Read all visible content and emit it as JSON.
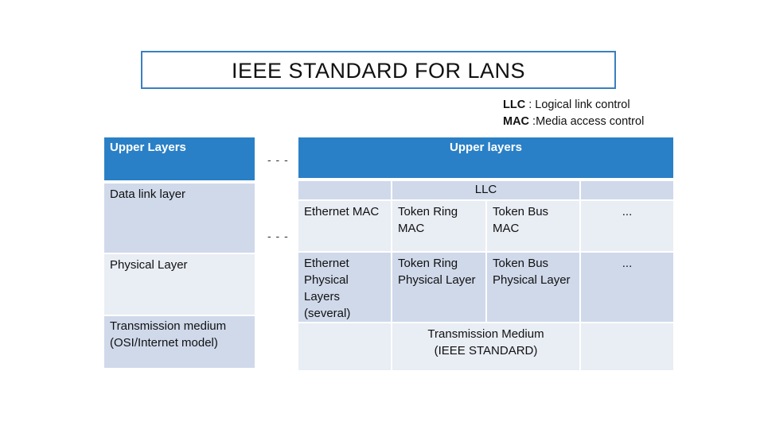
{
  "title": "IEEE  STANDARD  FOR LANS",
  "legend": [
    {
      "abbr": "LLC",
      "text": " : Logical link control"
    },
    {
      "abbr": "MAC",
      "text": " :Media access control"
    }
  ],
  "osi": {
    "upper": "Upper Layers",
    "datalink": "Data link layer",
    "physical": "Physical Layer",
    "medium_1": "Transmission medium",
    "medium_2": "(OSI/Internet model)"
  },
  "separator": "- - -",
  "ieee": {
    "upper": "Upper layers",
    "llc": "LLC",
    "eth_mac": "Ethernet MAC",
    "tr_mac_1": "Token Ring",
    "tr_mac_2": "MAC",
    "tb_mac_1": "Token Bus",
    "tb_mac_2": "MAC",
    "more": "...",
    "eth_phy_1": "Ethernet",
    "eth_phy_2": "Physical",
    "eth_phy_3": "Layers",
    "eth_phy_4": "(several)",
    "tr_phy_1": "Token Ring",
    "tr_phy_2": "Physical Layer",
    "tb_phy_1": "Token Bus",
    "tb_phy_2": "Physical Layer",
    "medium_1": "Transmission Medium",
    "medium_2": "(IEEE STANDARD)"
  },
  "colors": {
    "header": "#2a80c6",
    "row_dark": "#cfd9ea",
    "row_light": "#e9edf4",
    "title_border": "#3a7fc0"
  }
}
